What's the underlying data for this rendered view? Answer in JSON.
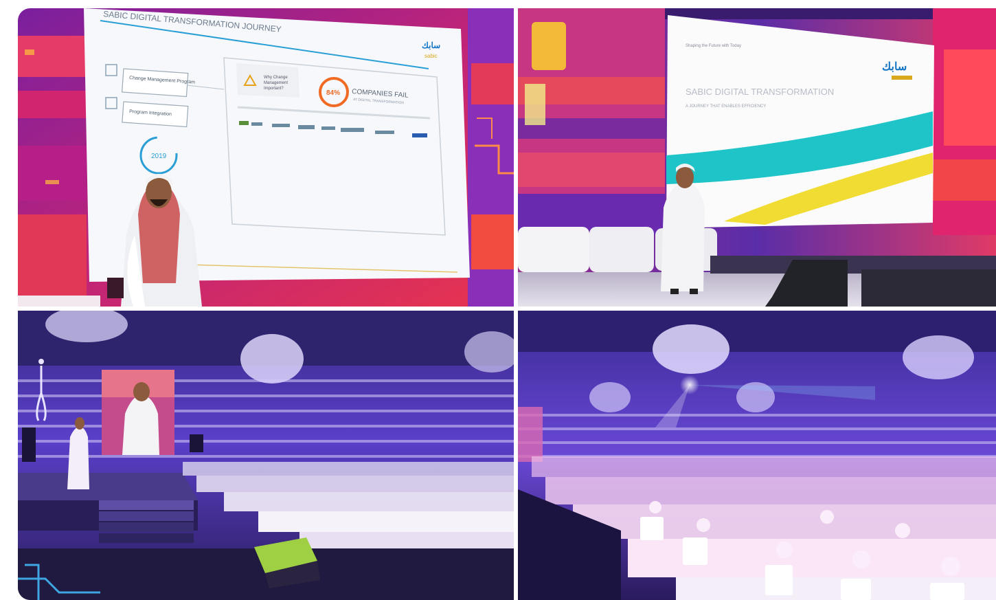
{
  "photos": [
    {
      "slide": {
        "title": "SABIC DIGITAL TRANSFORMATION JOURNEY",
        "brand_ar": "سابك",
        "brand_ar_sub": "sabic",
        "box1": "Change Management Program",
        "box2": "Program Integration",
        "year": "2019",
        "warn_text_1": "Why Change",
        "warn_text_2": "Management",
        "warn_text_3": "Important?",
        "percent": "84%",
        "companies": "COMPANIES FAIL",
        "companies_sub": "AT DIGITAL TRANSFORMATION"
      }
    },
    {
      "slide": {
        "small_title": "Shaping the Future with Today",
        "title": "SABIC DIGITAL TRANSFORMATION",
        "subtitle": "A JOURNEY THAT ENABLES EFFICIENCY",
        "brand_ar": "سابك"
      }
    },
    {},
    {}
  ],
  "colors": {
    "stage_magenta": "#e0246e",
    "stage_purple": "#6a2bb0",
    "venue_violet": "#5a3fc9",
    "slide_teal": "#1fc4c9",
    "slide_yellow": "#f1dc34",
    "brand_blue": "#1476c4",
    "brand_yellow": "#d9a81c"
  }
}
